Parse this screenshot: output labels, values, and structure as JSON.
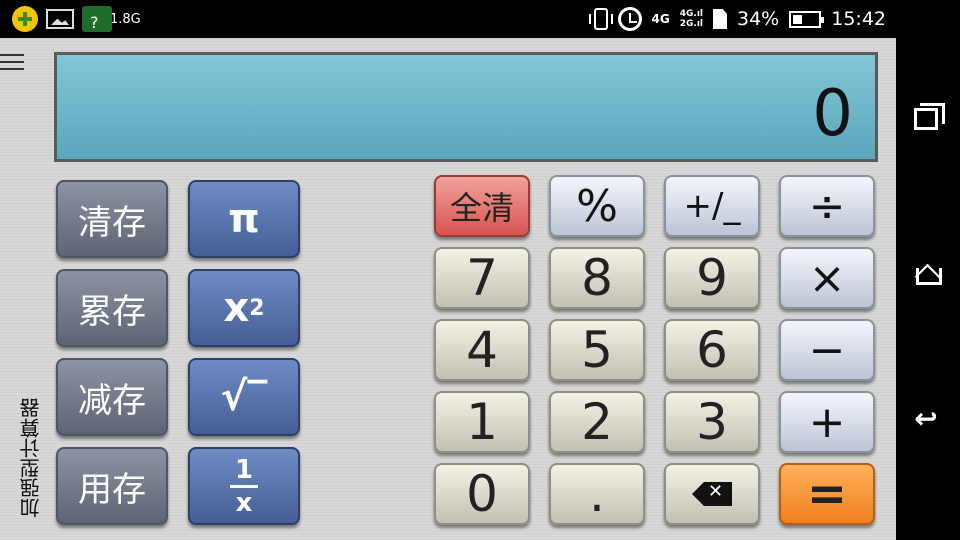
{
  "status_bar": {
    "net_speed": "1.8G",
    "net_question": "?",
    "network_4g": "4G",
    "signal_labels": [
      "4G.ıl",
      "2G.ıl"
    ],
    "battery": "34%",
    "time": "15:42"
  },
  "display": {
    "value": "0"
  },
  "app_title": "加强型计算器",
  "memory_buttons": [
    "清存",
    "累存",
    "减存",
    "用存"
  ],
  "function_buttons": {
    "pi": "π",
    "square_base": "x",
    "square_exp": "2",
    "sqrt": "√‾",
    "recip_num": "1",
    "recip_den": "x"
  },
  "keypad": {
    "clear_all": "全清",
    "percent": "%",
    "sign": "+/_",
    "divide": "÷",
    "multiply": "×",
    "minus": "−",
    "plus": "+",
    "equals": "=",
    "dot": ".",
    "digits": [
      "0",
      "1",
      "2",
      "3",
      "4",
      "5",
      "6",
      "7",
      "8",
      "9"
    ]
  },
  "colors": {
    "display_bg": "#6fb8cc",
    "memory_btn": "#6b7384",
    "function_btn": "#5873ad",
    "clear_btn": "#e4706b",
    "equals_btn": "#f5922d"
  }
}
